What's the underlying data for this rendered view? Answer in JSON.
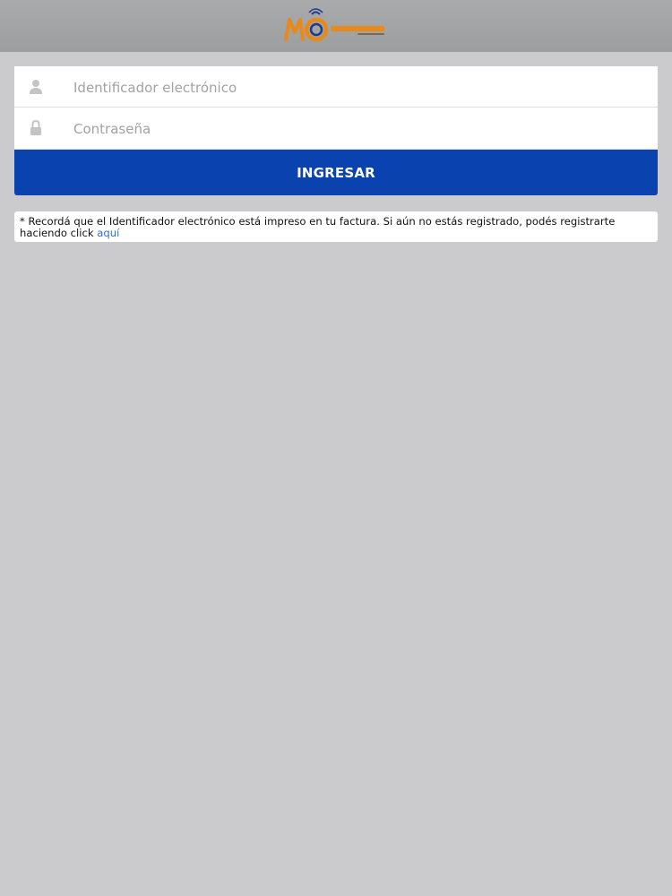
{
  "header": {
    "logo_name": "MagnetoMio"
  },
  "login": {
    "id_placeholder": "Identificador electrónico",
    "password_placeholder": "Contraseña",
    "submit_label": "INGRESAR"
  },
  "notice": {
    "text": "* Recordá que el Identificador electrónico está impreso en tu factura. Si aún no estás registrado, podés registrarte haciendo click ",
    "link_label": "aquí"
  },
  "colors": {
    "background": "#cbcbcd",
    "header": "#a2a3a5",
    "button": "#0a42b0",
    "link": "#2f6fd0",
    "logo_orange": "#e8891c",
    "logo_blue": "#1f3b8c"
  }
}
